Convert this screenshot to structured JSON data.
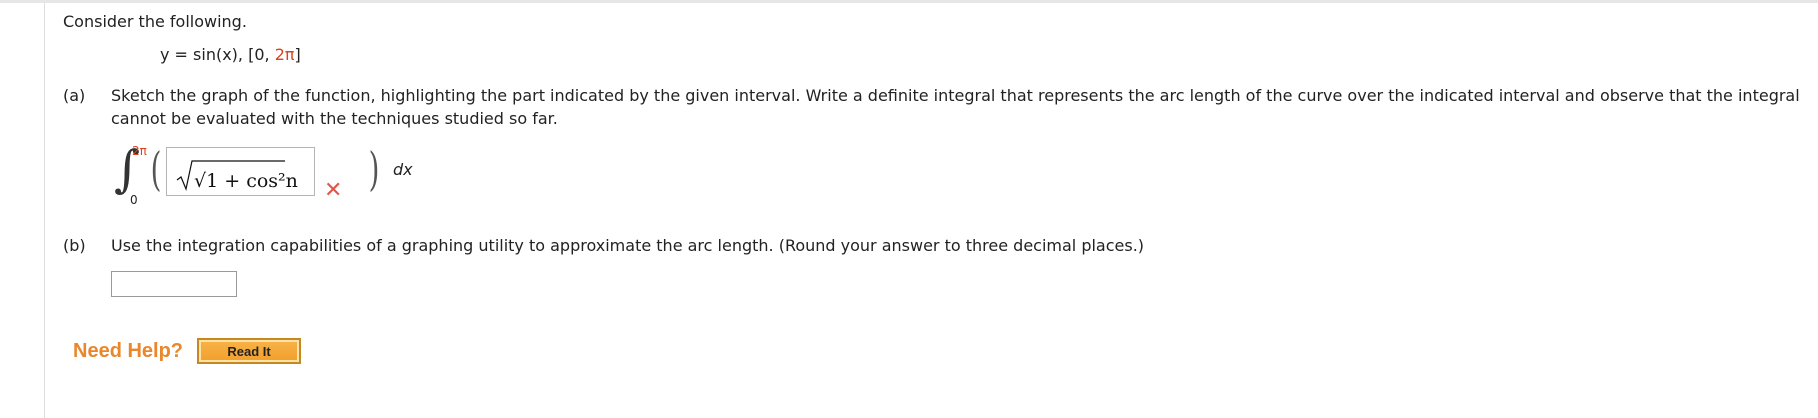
{
  "question": {
    "intro": "Consider the following.",
    "given_function": "y = sin(x),  [0, ",
    "given_interval_upper": "2π",
    "given_close": "]",
    "part_a": {
      "letter": "(a)",
      "text": "Sketch the graph of the function, highlighting the part indicated by the given interval. Write a definite integral that represents the arc length of the curve over the indicated interval and observe that the integral cannot be evaluated with the techniques studied so far.",
      "upper_limit": "2π",
      "lower_limit": "0",
      "integrand_entered": "√1 + cos²n",
      "differential": "dx",
      "status": "incorrect",
      "status_icon": "x-mark-icon",
      "status_color": "#e2574c"
    },
    "part_b": {
      "letter": "(b)",
      "text": "Use the integration capabilities of a graphing utility to approximate the arc length. (Round your answer to three decimal places.)",
      "answer_value": ""
    }
  },
  "help": {
    "label": "Need Help?",
    "read_it_label": "Read It"
  },
  "colors": {
    "accent_red": "#d9431e",
    "help_orange": "#e8872b",
    "button_orange": "#f29f2c"
  }
}
